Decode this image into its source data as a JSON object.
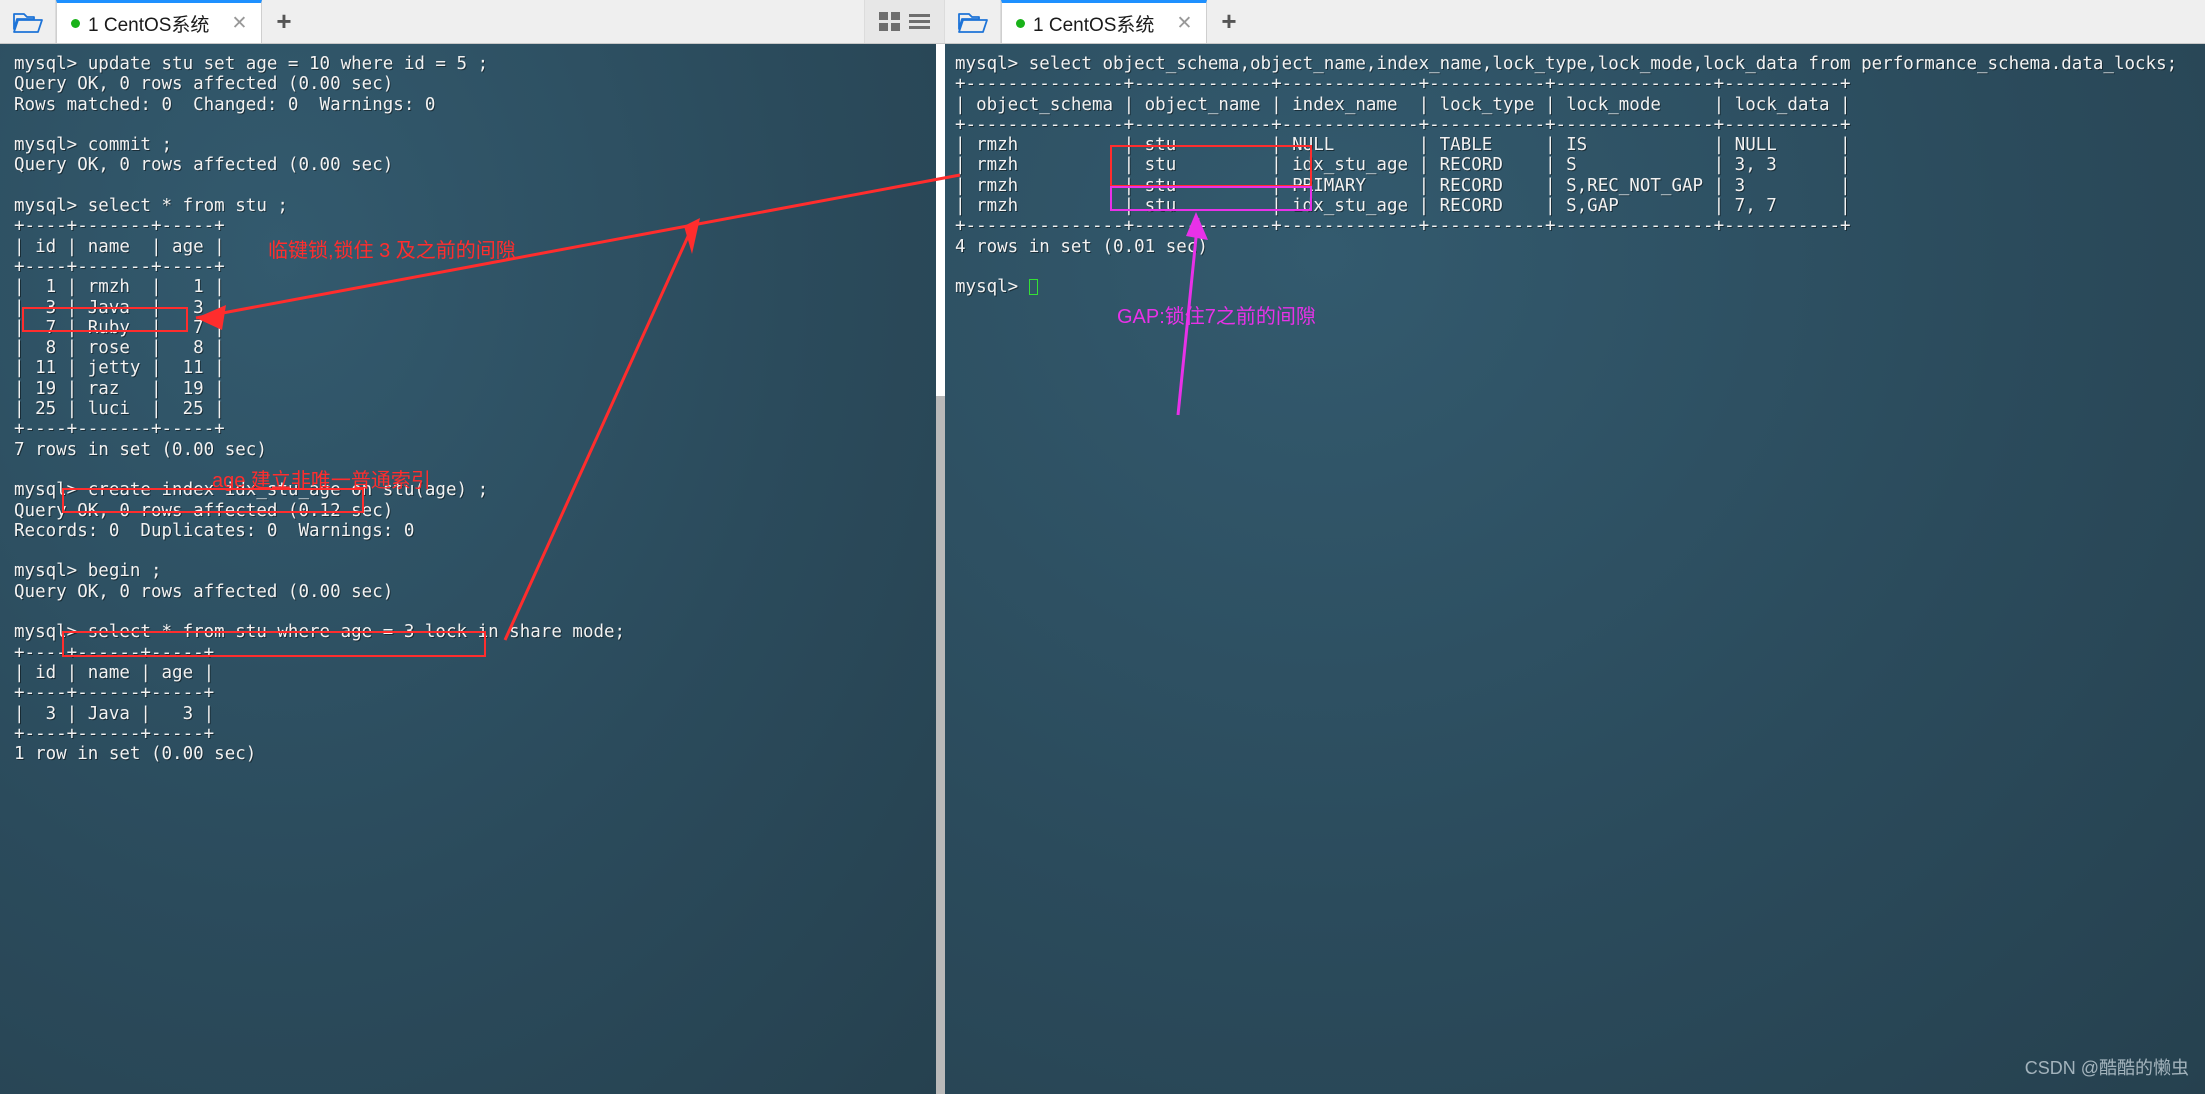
{
  "window": {
    "left_tabbar": {
      "folder_icon": "folder-icon",
      "tab": {
        "title": "1 CentOS系统",
        "status_dot_color": "#19b219",
        "close_label": "✕"
      },
      "new_tab_label": "+"
    },
    "right_tabbar": {
      "grid_icon": "grid-view-icon",
      "list_icon": "list-view-icon",
      "folder_icon": "folder-icon",
      "tab": {
        "title": "1 CentOS系统",
        "status_dot_color": "#19b219",
        "close_label": "✕"
      },
      "new_tab_label": "+"
    }
  },
  "left_terminal": {
    "text": "mysql> update stu set age = 10 where id = 5 ;\nQuery OK, 0 rows affected (0.00 sec)\nRows matched: 0  Changed: 0  Warnings: 0\n\nmysql> commit ;\nQuery OK, 0 rows affected (0.00 sec)\n\nmysql> select * from stu ;\n+----+-------+-----+\n| id | name  | age |\n+----+-------+-----+\n|  1 | rmzh  |   1 |\n|  3 | Java  |   3 |\n|  7 | Ruby  |   7 |\n|  8 | rose  |   8 |\n| 11 | jetty |  11 |\n| 19 | raz   |  19 |\n| 25 | luci  |  25 |\n+----+-------+-----+\n7 rows in set (0.00 sec)\n\nmysql> create index idx_stu_age on stu(age) ;\nQuery OK, 0 rows affected (0.12 sec)\nRecords: 0  Duplicates: 0  Warnings: 0\n\nmysql> begin ;\nQuery OK, 0 rows affected (0.00 sec)\n\nmysql> select * from stu where age = 3 lock in share mode;\n+----+------+-----+\n| id | name | age |\n+----+------+-----+\n|  3 | Java |   3 |\n+----+------+-----+\n1 row in set (0.00 sec)"
  },
  "right_terminal": {
    "text_before_cursor": "mysql> select object_schema,object_name,index_name,lock_type,lock_mode,lock_data from performance_schema.data_locks;\n+---------------+-------------+-------------+-----------+---------------+-----------+\n| object_schema | object_name | index_name  | lock_type | lock_mode     | lock_data |\n+---------------+-------------+-------------+-----------+---------------+-----------+\n| rmzh          | stu         | NULL        | TABLE     | IS            | NULL      |\n| rmzh          | stu         | idx_stu_age | RECORD    | S             | 3, 3      |\n| rmzh          | stu         | PRIMARY     | RECORD    | S,REC_NOT_GAP | 3         |\n| rmzh          | stu         | idx_stu_age | RECORD    | S,GAP         | 7, 7      |\n+---------------+-------------+-------------+-----------+---------------+-----------+\n4 rows in set (0.01 sec)\n\nmysql> ",
    "prompt_cursor": "block-cursor"
  },
  "annotations": {
    "next_key_lock_note": {
      "text": "临键锁,锁住 3 及之前的间隙",
      "color": "#ff2d2d"
    },
    "index_note": {
      "text": "age 建立非唯一普通索引",
      "color": "#ff2d2d"
    },
    "gap_note": {
      "text": "GAP:锁住7之前的间隙",
      "color": "#e831e8"
    },
    "highlight_color_red": "#ff2d2d",
    "highlight_color_magenta": "#e831e8"
  },
  "watermark": {
    "text": "CSDN @酷酷的懒虫"
  }
}
